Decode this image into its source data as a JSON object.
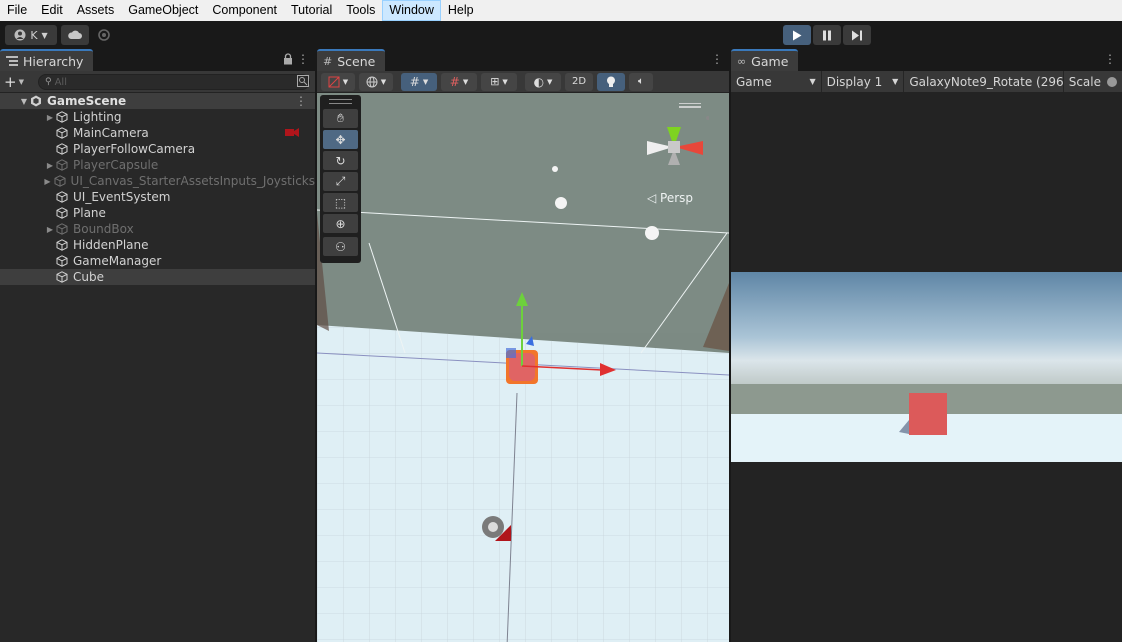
{
  "menu": [
    "File",
    "Edit",
    "Assets",
    "GameObject",
    "Component",
    "Tutorial",
    "Tools",
    "Window",
    "Help"
  ],
  "toolbar": {
    "account_label": "K",
    "account_icon": "account-icon",
    "cloud_icon": "cloud-icon",
    "collab_icon": "collab-icon",
    "play_icon": "play-icon",
    "pause_icon": "pause-icon",
    "step_icon": "step-icon"
  },
  "hierarchy": {
    "tab_title": "Hierarchy",
    "search_placeholder": "All",
    "scene_name": "GameScene",
    "items": [
      {
        "label": "Lighting",
        "has_children": true,
        "dim": false
      },
      {
        "label": "MainCamera",
        "has_children": false,
        "dim": false
      },
      {
        "label": "PlayerFollowCamera",
        "has_children": false,
        "dim": false
      },
      {
        "label": "PlayerCapsule",
        "has_children": true,
        "dim": true
      },
      {
        "label": "UI_Canvas_StarterAssetsInputs_Joysticks",
        "has_children": true,
        "dim": true
      },
      {
        "label": "UI_EventSystem",
        "has_children": false,
        "dim": false
      },
      {
        "label": "Plane",
        "has_children": false,
        "dim": false
      },
      {
        "label": "BoundBox",
        "has_children": true,
        "dim": true
      },
      {
        "label": "HiddenPlane",
        "has_children": false,
        "dim": false
      },
      {
        "label": "GameManager",
        "has_children": false,
        "dim": false
      },
      {
        "label": "Cube",
        "has_children": false,
        "dim": false,
        "selected": true
      }
    ]
  },
  "scene": {
    "tab_title": "Scene",
    "mode_2d": "2D",
    "persp_label": "◁ Persp"
  },
  "game": {
    "tab_title": "Game",
    "view_mode": "Game",
    "display": "Display 1",
    "resolution": "GalaxyNote9_Rotate (296",
    "scale_label": "Scale"
  },
  "colors": {
    "accent": "#46607c",
    "tab_accent": "#3a79bb",
    "cube": "#dc5a5a",
    "sky_top": "#6d8fab",
    "ground": "#e4f3f9"
  }
}
